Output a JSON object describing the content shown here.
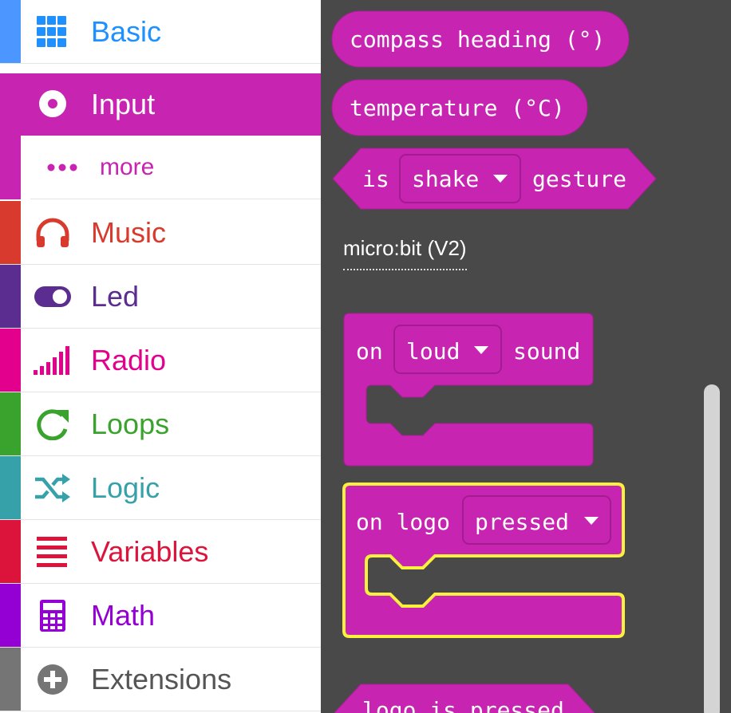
{
  "sidebar": {
    "categories": [
      {
        "label": "Basic",
        "color": "#1e90ff",
        "icon": "grid-icon"
      },
      {
        "label": "Input",
        "color": "#c724b1",
        "icon": "target-icon",
        "selected": true
      },
      {
        "label": "more",
        "color": "#c724b1",
        "icon": "ellipsis-icon",
        "sub": true
      },
      {
        "label": "Music",
        "color": "#d83b2e",
        "icon": "headphones-icon"
      },
      {
        "label": "Led",
        "color": "#5c2d91",
        "icon": "toggle-icon"
      },
      {
        "label": "Radio",
        "color": "#e3008c",
        "icon": "signal-bars-icon"
      },
      {
        "label": "Loops",
        "color": "#3aa32e",
        "icon": "loop-arrow-icon"
      },
      {
        "label": "Logic",
        "color": "#37a1a9",
        "icon": "shuffle-icon"
      },
      {
        "label": "Variables",
        "color": "#dc143c",
        "icon": "list-lines-icon"
      },
      {
        "label": "Math",
        "color": "#9400d3",
        "icon": "calculator-icon"
      },
      {
        "label": "Extensions",
        "color": "#757575",
        "icon": "plus-circle-icon"
      }
    ]
  },
  "flyout": {
    "compass_block": "compass heading (°)",
    "temperature_block": "temperature (°C)",
    "gesture_block": {
      "prefix": "is",
      "dropdown": "shake",
      "suffix": "gesture"
    },
    "section_label": "micro:bit (V2)",
    "sound_block": {
      "prefix": "on",
      "dropdown": "loud",
      "suffix": "sound"
    },
    "logo_block": {
      "prefix": "on logo",
      "dropdown": "pressed"
    },
    "logo_is_pressed_block": "logo is pressed",
    "block_color": "#c724b1",
    "highlight_color": "#fef13d"
  }
}
